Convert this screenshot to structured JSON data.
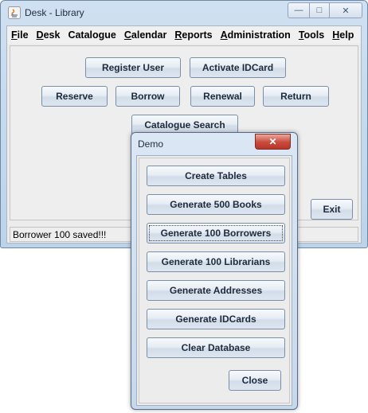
{
  "window": {
    "title": "Desk - Library",
    "caption": {
      "minimize": "—",
      "maximize": "□",
      "close": "✕"
    }
  },
  "menubar": [
    {
      "key": "F",
      "rest": "ile"
    },
    {
      "key": "D",
      "rest": "esk"
    },
    {
      "key": "",
      "rest": "Catalogue"
    },
    {
      "key": "C",
      "rest": "alendar"
    },
    {
      "key": "R",
      "rest": "eports"
    },
    {
      "key": "A",
      "rest": "dministration"
    },
    {
      "key": "T",
      "rest": "ools"
    },
    {
      "key": "H",
      "rest": "elp"
    }
  ],
  "main": {
    "register_user": "Register User",
    "activate_idcard": "Activate IDCard",
    "reserve": "Reserve",
    "borrow": "Borrow",
    "renewal": "Renewal",
    "return": "Return",
    "catalogue_search": "Catalogue Search",
    "exit": "Exit"
  },
  "status": {
    "text": "Borrower 100 saved!!!"
  },
  "demo_dialog": {
    "title": "Demo",
    "close_glyph": "✕",
    "buttons": {
      "create_tables": "Create Tables",
      "generate_books": "Generate 500 Books",
      "generate_borrowers": "Generate 100 Borrowers",
      "generate_librarians": "Generate 100 Librarians",
      "generate_addresses": "Generate Addresses",
      "generate_idcards": "Generate IDCards",
      "clear_database": "Clear Database",
      "close": "Close"
    }
  }
}
